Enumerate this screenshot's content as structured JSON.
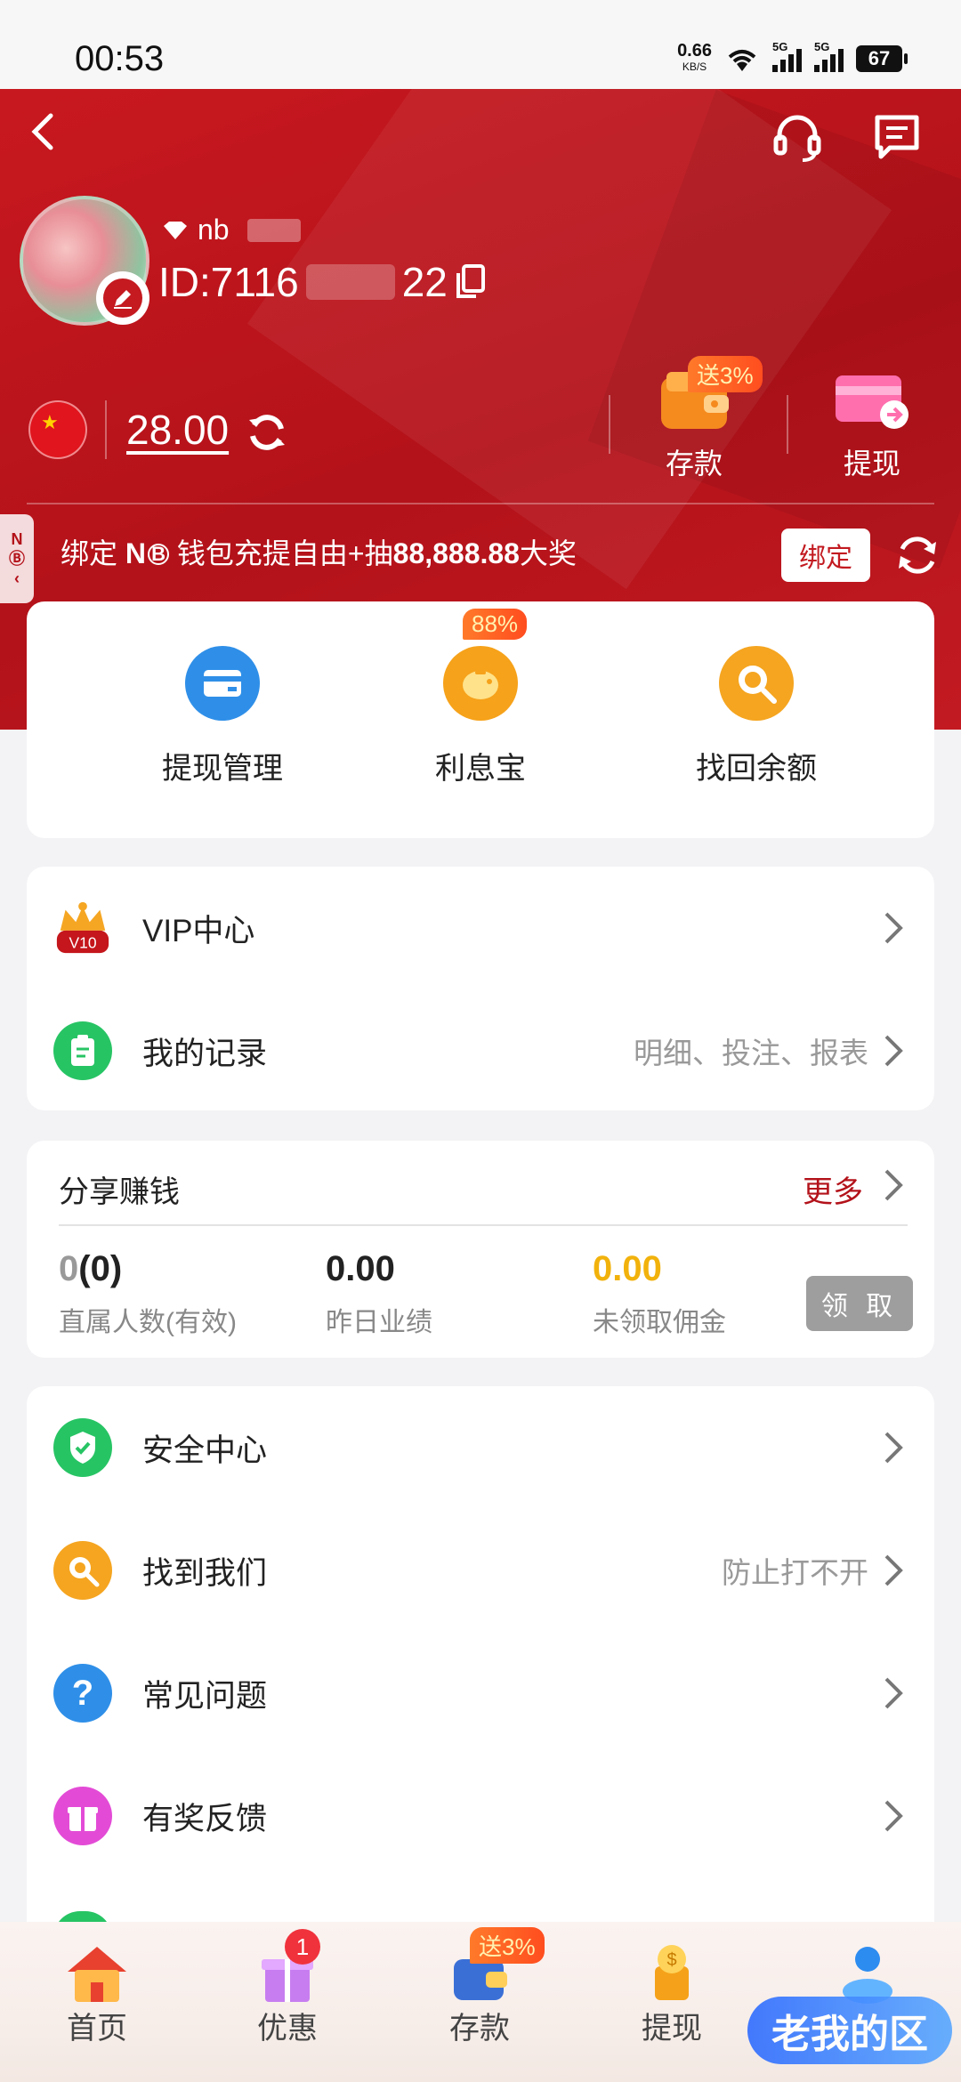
{
  "status_bar": {
    "time": "00:53",
    "net_speed": "0.66",
    "net_unit": "KB/S",
    "signal1_label": "5G",
    "signal2_label": "5G",
    "battery": "67"
  },
  "header": {
    "username": "nb",
    "user_id": "ID:7116",
    "user_id_suffix": "22",
    "balance": "28.00",
    "deposit_label": "存款",
    "deposit_badge": "送3%",
    "withdraw_label": "提现",
    "promo_prefix": "绑定 ",
    "promo_brand": "N",
    "promo_mid": " 钱包充提自由+抽",
    "promo_amount": "88,888.88",
    "promo_suffix": "大奖",
    "bind_label": "绑定",
    "side_tab_text": "N"
  },
  "quick_actions": [
    {
      "label": "提现管理",
      "badge": "",
      "color": "#2f8fe8"
    },
    {
      "label": "利息宝",
      "badge": "88%",
      "color": "#f6a21a"
    },
    {
      "label": "找回余额",
      "badge": "",
      "color": "#f5a520"
    }
  ],
  "menu1": [
    {
      "label": "VIP中心",
      "hint": "",
      "icon_badge": "V10"
    },
    {
      "label": "我的记录",
      "hint": "明细、投注、报表"
    }
  ],
  "share": {
    "title": "分享赚钱",
    "more": "更多",
    "stat1_value_gray": "0",
    "stat1_value": "(0)",
    "stat1_label": "直属人数(有效)",
    "stat2_value": "0.00",
    "stat2_label": "昨日业绩",
    "stat3_value": "0.00",
    "stat3_label": "未领取佣金",
    "claim": "领 取"
  },
  "menu2": [
    {
      "label": "安全中心",
      "hint": ""
    },
    {
      "label": "找到我们",
      "hint": "防止打不开"
    },
    {
      "label": "常见问题",
      "hint": ""
    },
    {
      "label": "有奖反馈",
      "hint": ""
    }
  ],
  "tabbar": {
    "home": "首页",
    "promo": "优惠",
    "promo_badge": "1",
    "deposit": "存款",
    "deposit_badge": "送3%",
    "withdraw": "提现",
    "watermark": "老我的区"
  },
  "colors": {
    "brand_red": "#b3121a",
    "claim_gray": "#9e9e9e",
    "gold": "#f2b20c"
  }
}
